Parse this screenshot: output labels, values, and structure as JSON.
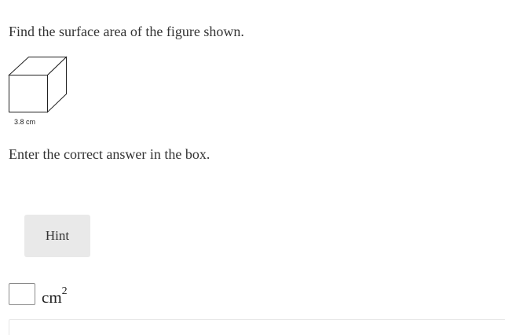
{
  "question": {
    "text": "Find the surface area of the figure shown."
  },
  "figure": {
    "shape": "cube",
    "dimension_label": "3.8 cm"
  },
  "instruction": {
    "text": "Enter the correct answer in the box."
  },
  "hint": {
    "label": "Hint"
  },
  "answer": {
    "value": "",
    "unit_base": "cm",
    "unit_exponent": "2"
  },
  "colors": {
    "text": "#333333",
    "hint_background": "#e9e9e9",
    "input_border": "#8a8a8a",
    "panel_border": "#e6e6e6"
  }
}
